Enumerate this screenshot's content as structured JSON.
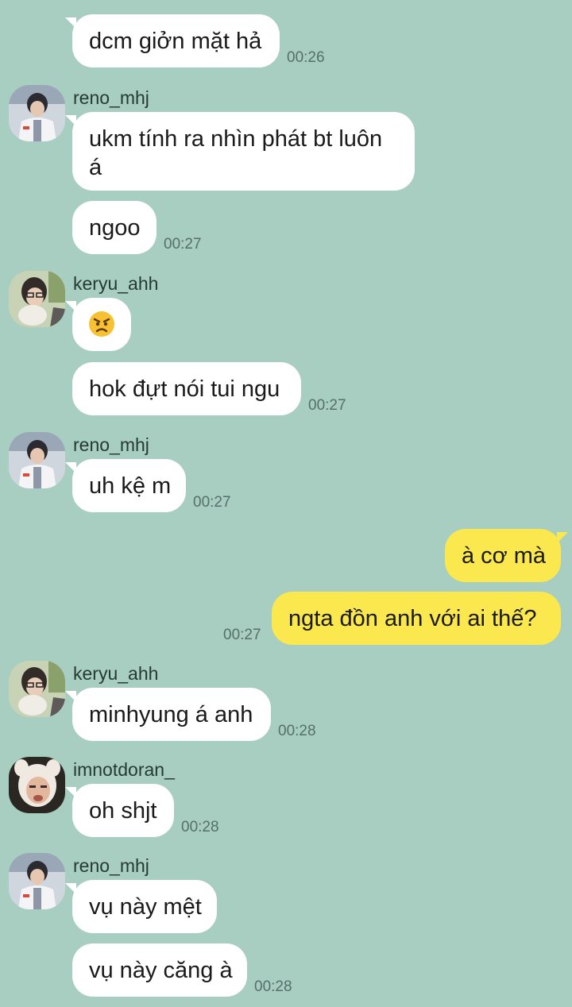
{
  "colors": {
    "background": "#a7cec0",
    "incoming_bubble": "#ffffff",
    "outgoing_bubble": "#fbe74e"
  },
  "messages": {
    "m1": {
      "text": "dcm giởn mặt hả",
      "time": "00:26"
    },
    "m2": {
      "sender": "reno_mhj",
      "text": "ukm tính ra nhìn phát bt luôn á"
    },
    "m3": {
      "text": "ngoo",
      "time": "00:27"
    },
    "m4": {
      "sender": "keryu_ahh",
      "emoji": "angry-face-icon"
    },
    "m5": {
      "text": "hok đựt nói tui ngu",
      "time": "00:27"
    },
    "m6": {
      "sender": "reno_mhj",
      "text": "uh kệ m",
      "time": "00:27"
    },
    "m7": {
      "text": "à cơ mà"
    },
    "m8": {
      "text": "ngta đồn anh với ai thế?",
      "time": "00:27"
    },
    "m9": {
      "sender": "keryu_ahh",
      "text": "minhyung á anh",
      "time": "00:28"
    },
    "m10": {
      "sender": "imnotdoran_",
      "text": "oh shjt",
      "time": "00:28"
    },
    "m11": {
      "sender": "reno_mhj",
      "text": "vụ này mệt"
    },
    "m12": {
      "text": "vụ này căng à",
      "time": "00:28"
    }
  }
}
